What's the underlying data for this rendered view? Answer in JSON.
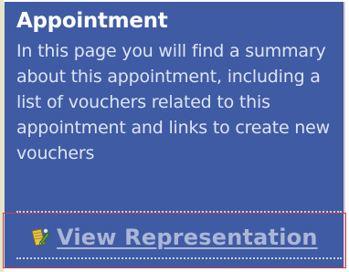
{
  "help_panel": {
    "title": "Appointment",
    "description": "In this page you will find a summary about this appointment, including a list of vouchers related to this appointment and links to create new vouchers"
  },
  "actions": {
    "view_representation": {
      "label": "View Representation",
      "icon": "document-edit-icon"
    }
  },
  "colors": {
    "panel_background": "#3f5ba4",
    "link_text": "#aab6d6",
    "selection_border": "#c8404a"
  }
}
